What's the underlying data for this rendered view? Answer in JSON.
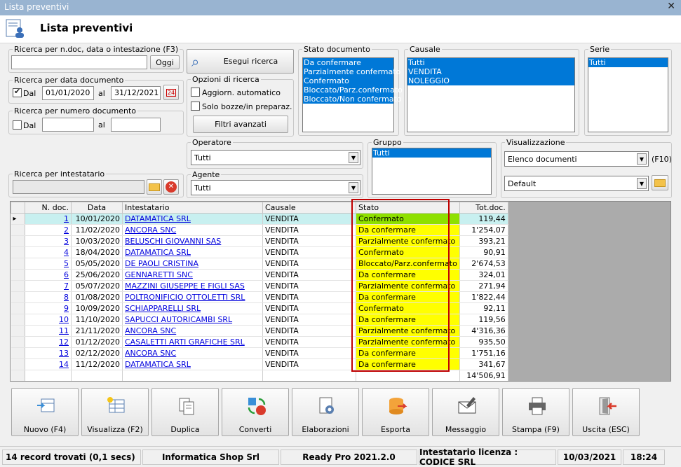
{
  "window": {
    "title": "Lista preventivi"
  },
  "header": {
    "title": "Lista preventivi"
  },
  "search_ndoc": {
    "legend": "Ricerca per n.doc, data o intestazione (F3)",
    "value": "",
    "oggi": "Oggi"
  },
  "esegui": "Esegui ricerca",
  "data_doc": {
    "legend": "Ricerca per data documento",
    "dal": "Dal",
    "from": "01/01/2020",
    "al": "al",
    "to": "31/12/2021",
    "checked": true
  },
  "num_doc": {
    "legend": "Ricerca per numero documento",
    "dal": "Dal",
    "from": "",
    "al": "al",
    "to": ""
  },
  "opzioni": {
    "legend": "Opzioni di ricerca",
    "opt1": "Aggiorn. automatico",
    "opt2": "Solo bozze/in preparaz.",
    "filtri": "Filtri avanzati"
  },
  "stato_doc": {
    "legend": "Stato documento",
    "items": [
      "Da confermare",
      "Parzialmente confermato",
      "Confermato",
      "Bloccato/Parz.confermato",
      "Bloccato/Non confermato"
    ]
  },
  "causale": {
    "legend": "Causale",
    "items": [
      "Tutti",
      "VENDITA",
      "NOLEGGIO"
    ]
  },
  "serie": {
    "legend": "Serie",
    "items": [
      "Tutti"
    ]
  },
  "operatore": {
    "legend": "Operatore",
    "value": "Tutti"
  },
  "gruppo": {
    "legend": "Gruppo",
    "items": [
      "Tutti"
    ]
  },
  "visualizzazione": {
    "legend": "Visualizzazione",
    "value1": "Elenco documenti",
    "f10": "(F10)",
    "value2": "Default"
  },
  "intestatario": {
    "legend": "Ricerca per intestatario",
    "value": ""
  },
  "agente": {
    "legend": "Agente",
    "value": "Tutti"
  },
  "table": {
    "columns": [
      "N. doc.",
      "Data",
      "Intestatario",
      "Causale",
      "Stato",
      "Tot.doc."
    ],
    "rows": [
      [
        "1",
        "10/01/2020",
        "DATAMATICA SRL",
        "VENDITA",
        "Confermato",
        "119,44"
      ],
      [
        "2",
        "11/02/2020",
        "ANCORA SNC",
        "VENDITA",
        "Da confermare",
        "1'254,07"
      ],
      [
        "3",
        "10/03/2020",
        "BELUSCHI GIOVANNI SAS",
        "VENDITA",
        "Parzialmente confermato",
        "393,21"
      ],
      [
        "4",
        "18/04/2020",
        "DATAMATICA SRL",
        "VENDITA",
        "Confermato",
        "90,91"
      ],
      [
        "5",
        "05/05/2020",
        "DE PAOLI CRISTINA",
        "VENDITA",
        "Bloccato/Parz.confermato",
        "2'674,53"
      ],
      [
        "6",
        "25/06/2020",
        "GENNARETTI SNC",
        "VENDITA",
        "Da confermare",
        "324,01"
      ],
      [
        "7",
        "05/07/2020",
        "MAZZINI GIUSEPPE E FIGLI SAS",
        "VENDITA",
        "Parzialmente confermato",
        "271,94"
      ],
      [
        "8",
        "01/08/2020",
        "POLTRONIFICIO OTTOLETTI SRL",
        "VENDITA",
        "Da confermare",
        "1'822,44"
      ],
      [
        "9",
        "10/09/2020",
        "SCHIAPPARELLI SRL",
        "VENDITA",
        "Confermato",
        "92,11"
      ],
      [
        "10",
        "11/10/2020",
        "SAPUCCI AUTORICAMBI SRL",
        "VENDITA",
        "Da confermare",
        "119,56"
      ],
      [
        "11",
        "21/11/2020",
        "ANCORA SNC",
        "VENDITA",
        "Parzialmente confermato",
        "4'316,36"
      ],
      [
        "12",
        "01/12/2020",
        "CASALETTI ARTI GRAFICHE SRL",
        "VENDITA",
        "Parzialmente confermato",
        "935,50"
      ],
      [
        "13",
        "02/12/2020",
        "ANCORA SNC",
        "VENDITA",
        "Da confermare",
        "1'751,16"
      ],
      [
        "14",
        "11/12/2020",
        "DATAMATICA SRL",
        "VENDITA",
        "Da confermare",
        "341,67"
      ]
    ],
    "total": "14'506,91"
  },
  "toolbar": [
    "Nuovo (F4)",
    "Visualizza (F2)",
    "Duplica",
    "Converti",
    "Elaborazioni",
    "Esporta",
    "Messaggio",
    "Stampa (F9)",
    "Uscita (ESC)"
  ],
  "status": {
    "records": "14 record trovati (0,1 secs)",
    "company": "Informatica Shop Srl",
    "version": "Ready Pro 2021.2.0",
    "license": "Intestatario licenza : CODICE SRL",
    "date": "10/03/2021",
    "time": "18:24"
  }
}
